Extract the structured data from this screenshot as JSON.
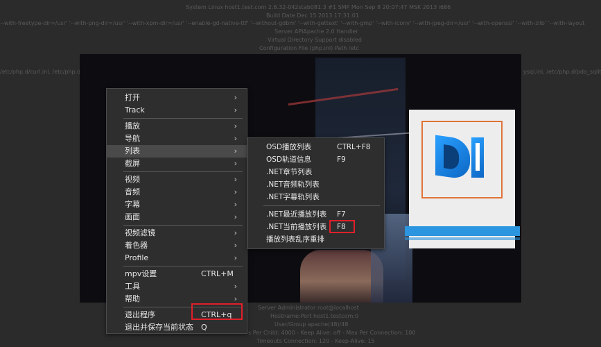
{
  "background_text": {
    "line1": "System      Linux host1.test.com 2.6.32-042stab081.3 #1 SMP Mon Sep 8 20:07:47 MSK 2013 i686",
    "line2": "Build Date      Dec 15 2013 17:31:01",
    "line3": "'--with-freetype-dir=/usr' '--with-png-dir=/usr' '--with-xpm-dir=/usr' '--enable-gd-native-ttf' '--without-gdbm' '--with-gettext' '--with-gmp' '--with-iconv' '--with-jpeg-dir=/usr' '--with-openssl' '--with-zlib' '--with-layout",
    "line4": "Server APIApache 2.0 Handler",
    "line5": "Virtual Directory Support disabled",
    "line6": "Configuration File (php.ini) Path      /etc",
    "line7_left": "/etc/php.d/curl.ini, /etc/php.d",
    "line7_right": "ysql.ini, /etc/php.d/pdo_sqlit",
    "line8": "Server Administrator        root@localhost",
    "line9": "Hostname:Port host1.testcom:0",
    "line10": "User/Group        apache(48)/48",
    "line11": "s   Per Child: 4000 - Keep Alive: off - Max Per Connection: 100",
    "line12": "Timeouts  Connection: 120 - Keep-Alive: 15"
  },
  "main_menu": {
    "items": [
      {
        "label": "打开",
        "shortcut": "",
        "submenu": true
      },
      {
        "label": "Track",
        "shortcut": "",
        "submenu": true
      },
      {
        "sep": true
      },
      {
        "label": "播放",
        "shortcut": "",
        "submenu": true
      },
      {
        "label": "导航",
        "shortcut": "",
        "submenu": true
      },
      {
        "label": "列表",
        "shortcut": "",
        "submenu": true,
        "highlighted": true
      },
      {
        "label": "截屏",
        "shortcut": "",
        "submenu": true
      },
      {
        "sep": true
      },
      {
        "label": "视频",
        "shortcut": "",
        "submenu": true
      },
      {
        "label": "音频",
        "shortcut": "",
        "submenu": true
      },
      {
        "label": "字幕",
        "shortcut": "",
        "submenu": true
      },
      {
        "label": "画面",
        "shortcut": "",
        "submenu": true
      },
      {
        "sep": true
      },
      {
        "label": "视频滤镜",
        "shortcut": "",
        "submenu": true
      },
      {
        "label": "着色器",
        "shortcut": "",
        "submenu": true
      },
      {
        "label": "Profile",
        "shortcut": "",
        "submenu": true
      },
      {
        "sep": true
      },
      {
        "label": "mpv设置",
        "shortcut": "CTRL+M",
        "submenu": false
      },
      {
        "label": "工具",
        "shortcut": "",
        "submenu": true
      },
      {
        "label": "帮助",
        "shortcut": "",
        "submenu": true
      },
      {
        "sep": true
      },
      {
        "label": "退出程序",
        "shortcut": "CTRL+q",
        "submenu": false
      },
      {
        "label": "退出并保存当前状态",
        "shortcut": "Q",
        "submenu": false
      }
    ]
  },
  "sub_menu": {
    "items": [
      {
        "label": "OSD播放列表",
        "shortcut": "CTRL+F8"
      },
      {
        "label": "OSD轨道信息",
        "shortcut": "F9"
      },
      {
        "label": ".NET章节列表",
        "shortcut": ""
      },
      {
        "label": ".NET音频轨列表",
        "shortcut": ""
      },
      {
        "label": ".NET字幕轨列表",
        "shortcut": ""
      },
      {
        "sep": true
      },
      {
        "label": ".NET最近播放列表",
        "shortcut": "F7"
      },
      {
        "label": ".NET当前播放列表",
        "shortcut": "F8"
      },
      {
        "label": "播放列表乱序重排",
        "shortcut": ""
      }
    ]
  },
  "icons": {
    "submenu_arrow": "chevron-right-icon"
  },
  "colors": {
    "menu_bg": "#2e2e2e",
    "highlight": "#4a4a4a",
    "annotation": "#e0202a"
  }
}
